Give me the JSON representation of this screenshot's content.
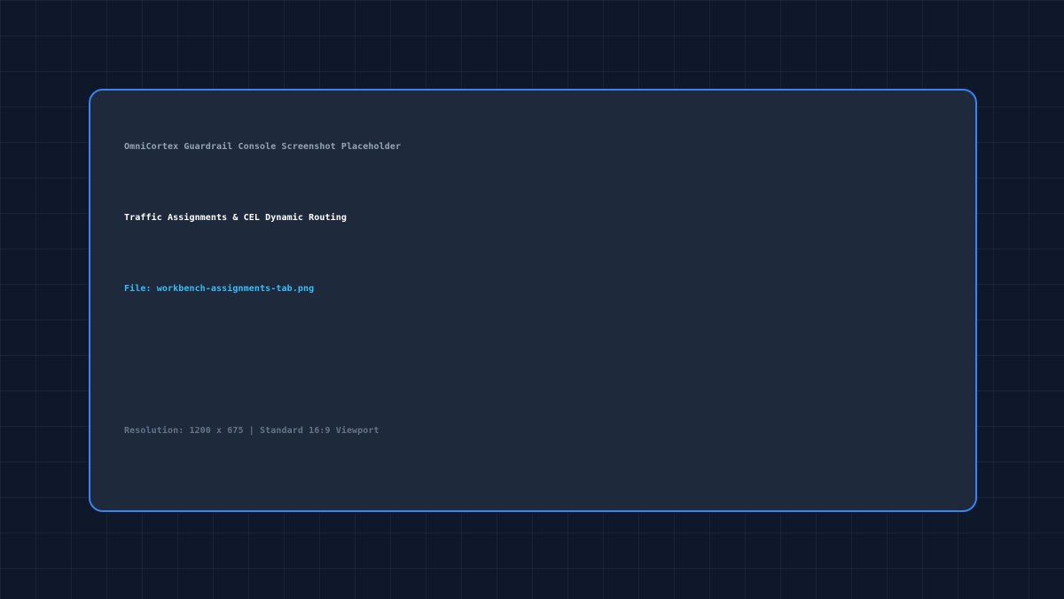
{
  "card": {
    "subtitle": "OmniCortex Guardrail Console Screenshot Placeholder",
    "title": "Traffic Assignments & CEL Dynamic Routing",
    "file_label": "File: workbench-assignments-tab.png",
    "resolution": "Resolution: 1200 x 675 | Standard 16:9 Viewport"
  },
  "colors": {
    "background": "#0f172a",
    "card": "#1e293b",
    "border": "#3b82f6",
    "title": "#ffffff",
    "subtitle": "#94a3b8",
    "file": "#38bdf8",
    "resolution": "#64748b"
  }
}
